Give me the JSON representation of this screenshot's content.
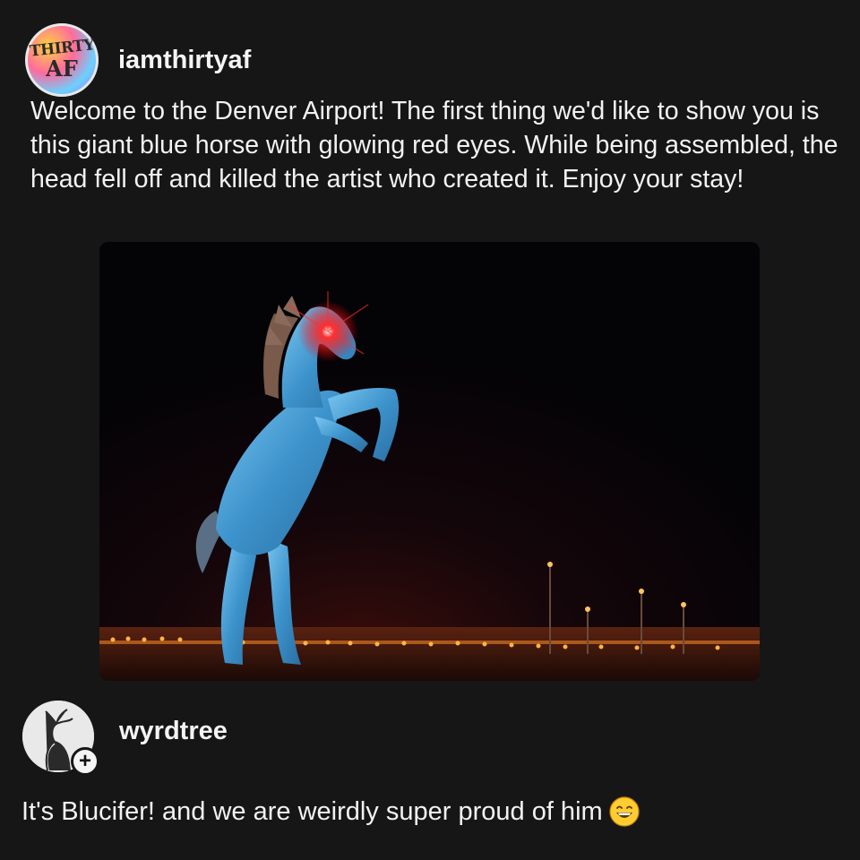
{
  "post": {
    "avatar_text_top": "THIRTY",
    "avatar_text_bottom": "AF",
    "username": "iamthirtyaf",
    "text": "Welcome to the Denver Airport! The first thing we'd like to show you is this giant blue horse with glowing red eyes. While being assembled, the head fell off and killed the artist who created it. Enjoy your stay!",
    "photo_alt": "giant blue horse statue with glowing red eyes at night"
  },
  "comment": {
    "username": "wyrdtree",
    "follow_icon": "plus-icon",
    "follow_symbol": "+",
    "text": "It's Blucifer! and we are weirdly super proud of him",
    "emoji": "grinning-face-emoji"
  },
  "colors": {
    "background": "#161616",
    "text": "#f2f2f2",
    "horse_blue": "#4aa3d8",
    "eye_red": "#ff2020",
    "lights_orange": "#ff9a30"
  }
}
